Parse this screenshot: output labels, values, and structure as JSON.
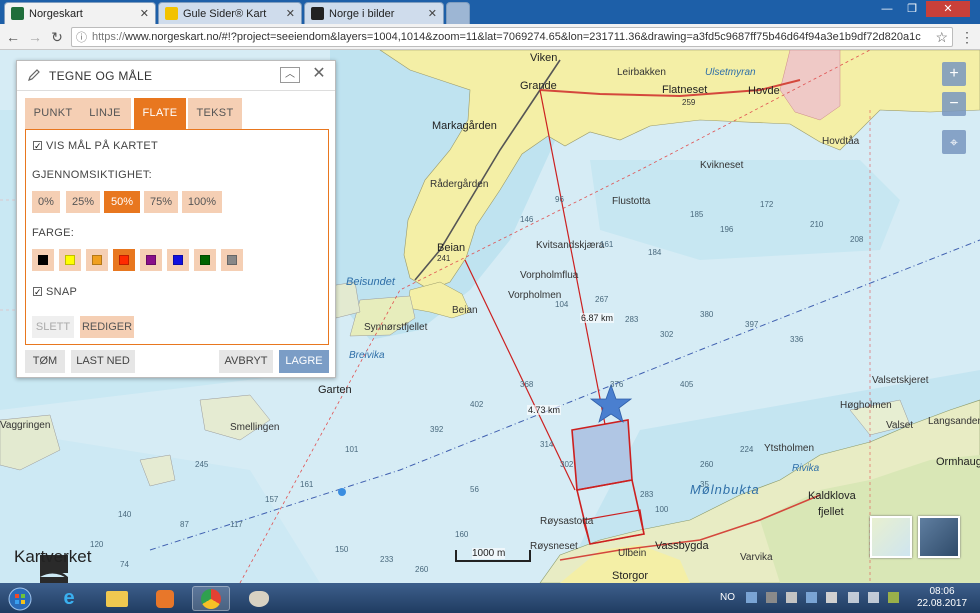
{
  "browser": {
    "tabs": [
      {
        "label": "Norgeskart",
        "favicon_color": "#1f6e3b",
        "active": true
      },
      {
        "label": "Gule Sider® Kart",
        "favicon_color": "#f2c200",
        "active": false
      },
      {
        "label": "Norge i bilder",
        "favicon_color": "#222222",
        "active": false
      }
    ],
    "url_prefix": "https://",
    "url_rest": "www.norgeskart.no/#!?project=seeiendom&layers=1004,1014&zoom=11&lat=7069274.65&lon=231711.36&drawing=a3fd5c9687ff75b46d64f94a3e1b9df72d820a1c"
  },
  "panel": {
    "title": "TEGNE OG MÅLE",
    "tabs": [
      "PUNKT",
      "LINJE",
      "FLATE",
      "TEKST"
    ],
    "active_tab": "FLATE",
    "show_measure_label": "VIS MÅL PÅ KARTET",
    "show_measure_checked": true,
    "opacity_label": "GJENNOMSIKTIGHET:",
    "opacity_options": [
      "0%",
      "25%",
      "50%",
      "75%",
      "100%"
    ],
    "opacity_selected": "50%",
    "color_label": "FARGE:",
    "colors": [
      "#000000",
      "#ffff00",
      "#f0a020",
      "#ff2a00",
      "#8a0f8a",
      "#1010e0",
      "#006400",
      "#888888"
    ],
    "color_selected": "#ff2a00",
    "snap_label": "SNAP",
    "snap_checked": true,
    "delete_label": "SLETT",
    "edit_label": "REDIGER",
    "clear_label": "TØM",
    "download_label": "LAST NED",
    "cancel_label": "AVBRYT",
    "save_label": "LAGRE"
  },
  "map": {
    "places": {
      "viken": "Viken",
      "grande": "Grande",
      "leirbakken": "Leirbakken",
      "ulsetmyran": "Ulsetmyran",
      "flatneset": "Flatneset",
      "hovde": "Hovde",
      "markagarden": "Markagården",
      "radergarden": "Rådergården",
      "beian": "Beian",
      "beian2": "Beian",
      "beiansundet": "Beisundet",
      "kvitsandskjaera": "Kvitsandskjæra",
      "flustotta": "Flustotta",
      "vorpholmflua": "Vorpholmflua",
      "vorpholmen": "Vorpholmen",
      "synnorstfjellet": "Synnørstfjellet",
      "breivika": "Breivika",
      "garten": "Garten",
      "smellingen": "Smellingen",
      "vagringen": "Vaggringen",
      "molnbukta": "Mølnbukta",
      "ytstholmen": "Ytstholmen",
      "rivika": "Rivika",
      "kaldklova": "Kaldklova",
      "fjellet": "fjellet",
      "ormhaugen": "Ormhaug-",
      "hogholmen": "Høgholmen",
      "valset": "Valset",
      "valsetskjeret": "Valsetskjeret",
      "royssastotta": "Røysastotta",
      "roysneset": "Røysneset",
      "ulbein": "Ulbein",
      "vassbygda": "Vassbygda",
      "varvika": "Varvika",
      "storgor": "Storgor",
      "lengsanden": "Langsanden",
      "hovdtaa": "Hovdtåa",
      "kvikneset": "Kvikneset",
      "road_241": "241",
      "road_259": "259"
    },
    "measurements": {
      "line1": "6.87 km",
      "line2": "4.73 km"
    },
    "depths": [
      "96",
      "146",
      "161",
      "184",
      "185",
      "196",
      "172",
      "210",
      "208",
      "104",
      "267",
      "283",
      "302",
      "380",
      "397",
      "336",
      "376",
      "405",
      "392",
      "402",
      "368",
      "314",
      "302",
      "283",
      "260",
      "224",
      "101",
      "161",
      "157",
      "117",
      "87",
      "245",
      "140",
      "120",
      "74",
      "56",
      "160",
      "260",
      "233",
      "150",
      "100",
      "35"
    ],
    "scale_label": "1000 m",
    "attribution": "Kartverket",
    "zoom_in": "+",
    "zoom_out": "−",
    "locate_icon": "crosshair-icon"
  },
  "taskbar": {
    "language": "NO",
    "time": "08:06",
    "date": "22.08.2017"
  }
}
